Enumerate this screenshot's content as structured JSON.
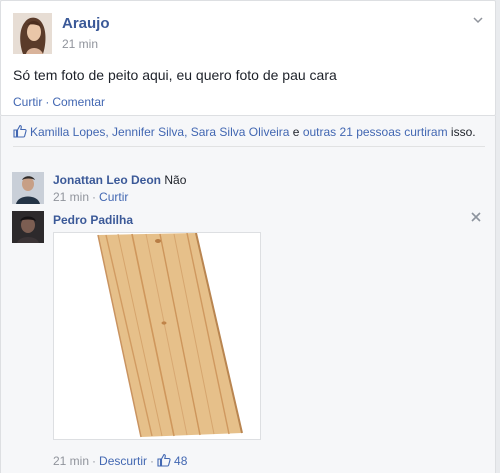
{
  "post": {
    "author": "Araujo",
    "time": "21 min",
    "text": "Só tem foto de peito aqui, eu quero foto de pau cara",
    "actions": {
      "like": "Curtir",
      "comment": "Comentar",
      "separator": "·"
    }
  },
  "likes": {
    "names": "Kamilla Lopes, Jennifer Silva, Sara Silva Oliveira",
    "connector": "e",
    "others": "outras 21 pessoas",
    "verb": "curtiram",
    "suffix": "isso."
  },
  "comments": [
    {
      "author": "Jonattan Leo Deon",
      "text": "Não",
      "time": "21 min",
      "action": "Curtir"
    },
    {
      "author": "Pedro Padilha",
      "time": "21 min",
      "action": "Descurtir",
      "like_count": "48"
    }
  ],
  "colors": {
    "link": "#3b5998",
    "action": "#4267b2",
    "meta": "#90949c",
    "wood": "#e2bc86"
  },
  "icons": {
    "like": "thumbs-up-icon",
    "options": "chevron-down-icon",
    "close": "close-icon"
  }
}
